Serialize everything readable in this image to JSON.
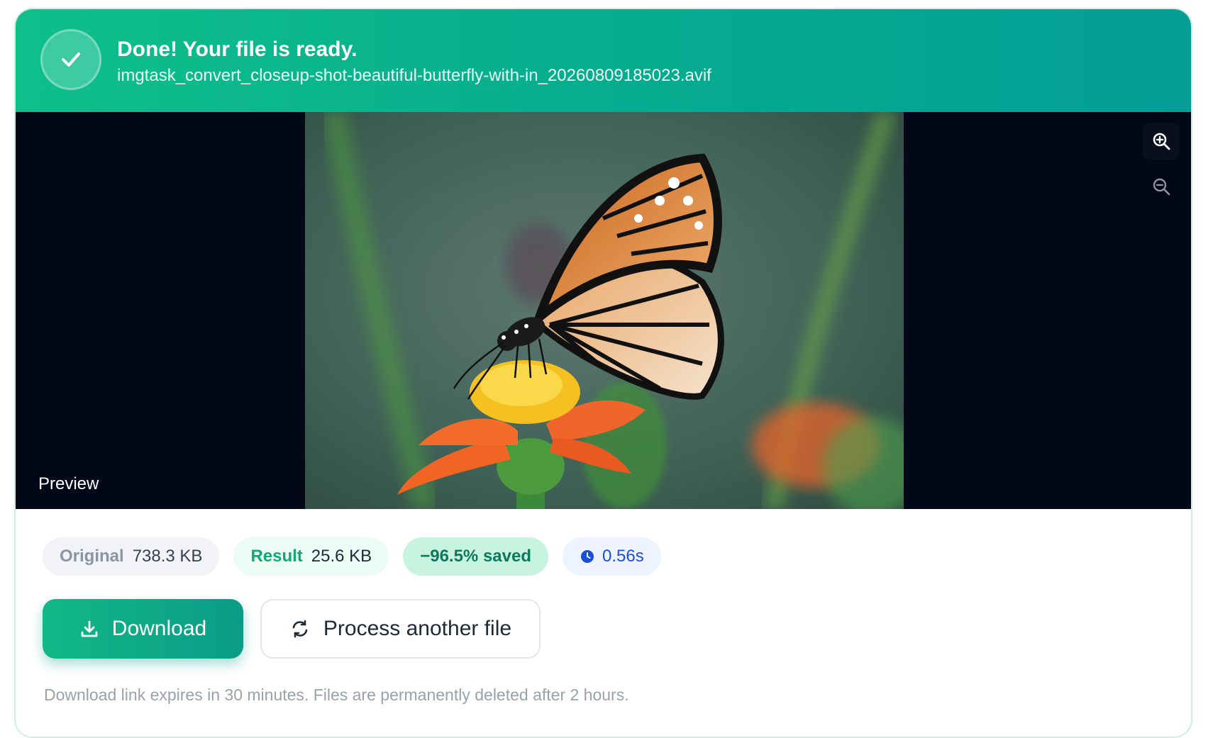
{
  "header": {
    "title": "Done! Your file is ready.",
    "filename": "imgtask_convert_closeup-shot-beautiful-butterfly-with-in_20260809185023.avif",
    "status_icon": "check-icon"
  },
  "preview": {
    "label": "Preview",
    "image_subject": "butterfly on orange flower",
    "zoom_in_icon": "zoom-in-icon",
    "zoom_out_icon": "zoom-out-icon"
  },
  "stats": {
    "original_label": "Original",
    "original_value": "738.3 KB",
    "result_label": "Result",
    "result_value": "25.6 KB",
    "saved": "−96.5% saved",
    "time_icon": "clock-icon",
    "time": "0.56s"
  },
  "actions": {
    "download_label": "Download",
    "download_icon": "download-icon",
    "process_label": "Process another file",
    "process_icon": "refresh-icon"
  },
  "footer_note": "Download link expires in 30 minutes. Files are permanently deleted after 2 hours.",
  "colors": {
    "header_start": "#0fbf8a",
    "header_end": "#049e96",
    "accent": "#12b886",
    "preview_bg": "#020817",
    "time_text": "#1d4ed8"
  }
}
